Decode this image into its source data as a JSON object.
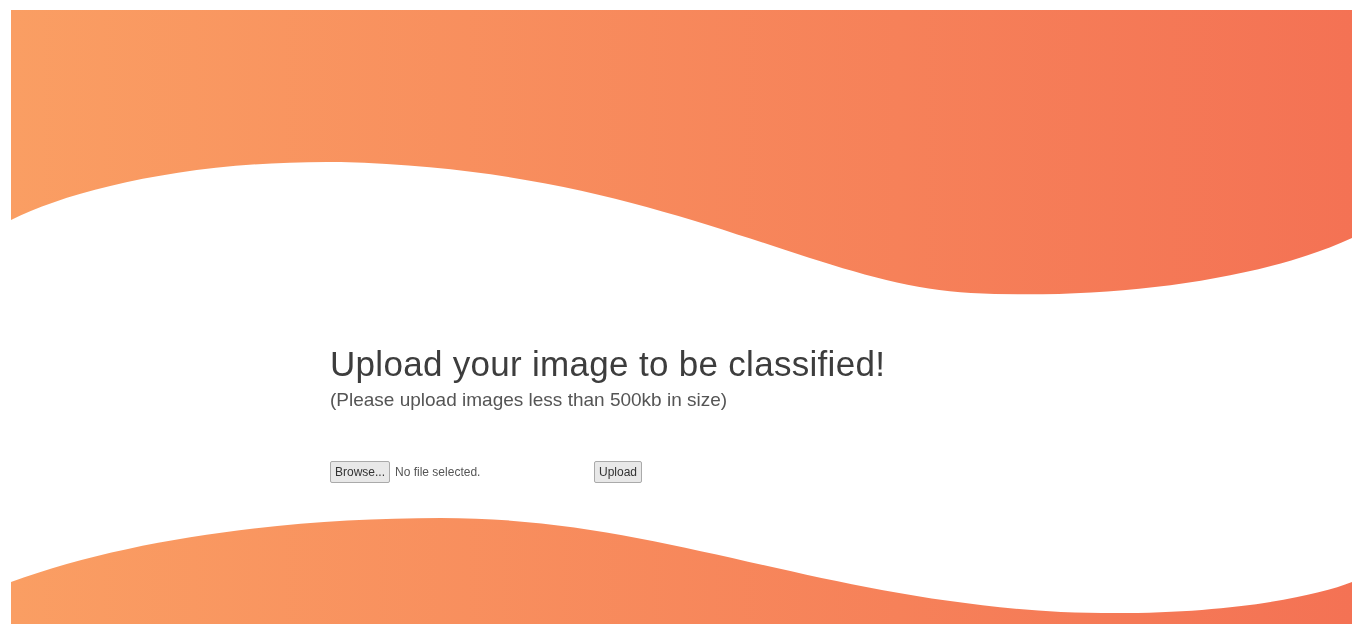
{
  "heading": "Upload your image to be classified!",
  "subheading": "(Please upload images less than 500kb in size)",
  "file_input": {
    "button_label": "Browse...",
    "status": "No file selected."
  },
  "upload_button": "Upload"
}
